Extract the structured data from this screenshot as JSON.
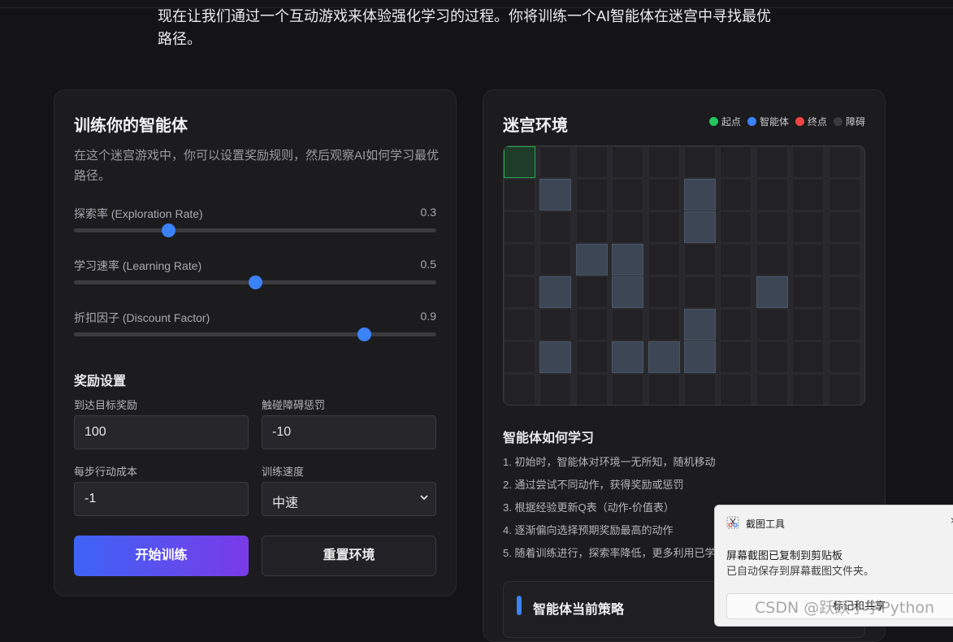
{
  "intro": "现在让我们通过一个互动游戏来体验强化学习的过程。你将训练一个AI智能体在迷宫中寻找最优路径。",
  "left_panel": {
    "title": "训练你的智能体",
    "description": "在这个迷宫游戏中，你可以设置奖励规则，然后观察AI如何学习最优路径。",
    "sliders": [
      {
        "label": "探索率 (Exploration Rate)",
        "value": "0.3",
        "fraction": 0.26
      },
      {
        "label": "学习速率 (Learning Rate)",
        "value": "0.5",
        "fraction": 0.5
      },
      {
        "label": "折扣因子 (Discount Factor)",
        "value": "0.9",
        "fraction": 0.8
      }
    ],
    "reward_title": "奖励设置",
    "fields": {
      "goal_reward": {
        "label": "到达目标奖励",
        "value": "100"
      },
      "obstacle_penalty": {
        "label": "触碰障碍惩罚",
        "value": "-10"
      },
      "step_cost": {
        "label": "每步行动成本",
        "value": "-1"
      },
      "speed": {
        "label": "训练速度",
        "value": "中速"
      }
    },
    "start_button": "开始训练",
    "reset_button": "重置环境"
  },
  "right_panel": {
    "title": "迷宫环境",
    "legend": [
      {
        "label": "起点",
        "color": "#22c55e"
      },
      {
        "label": "智能体",
        "color": "#3b82f6"
      },
      {
        "label": "终点",
        "color": "#ef4444"
      },
      {
        "label": "障碍",
        "color": "#3a3a40"
      }
    ],
    "maze": {
      "cols": 10,
      "rows": 8,
      "start": [
        0,
        0
      ],
      "obstacles": [
        [
          1,
          1
        ],
        [
          5,
          1
        ],
        [
          5,
          2
        ],
        [
          2,
          3
        ],
        [
          3,
          3
        ],
        [
          1,
          4
        ],
        [
          3,
          4
        ],
        [
          7,
          4
        ],
        [
          5,
          5
        ],
        [
          1,
          6
        ],
        [
          3,
          6
        ],
        [
          4,
          6
        ],
        [
          5,
          6
        ]
      ]
    },
    "how_title": "智能体如何学习",
    "steps": [
      "1. 初始时，智能体对环境一无所知，随机移动",
      "2. 通过尝试不同动作，获得奖励或惩罚",
      "3. 根据经验更新Q表（动作-价值表）",
      "4. 逐渐偏向选择预期奖励最高的动作",
      "5. 随着训练进行，探索率降低，更多利用已学知识"
    ],
    "policy_title": "智能体当前策略"
  },
  "toast": {
    "app": "截图工具",
    "close": "×",
    "title": "屏幕截图已复制到剪贴板",
    "subtitle": "已自动保存到屏幕截图文件夹。",
    "button": "标记和共享"
  },
  "watermark": "CSDN @跃跃小学Python"
}
